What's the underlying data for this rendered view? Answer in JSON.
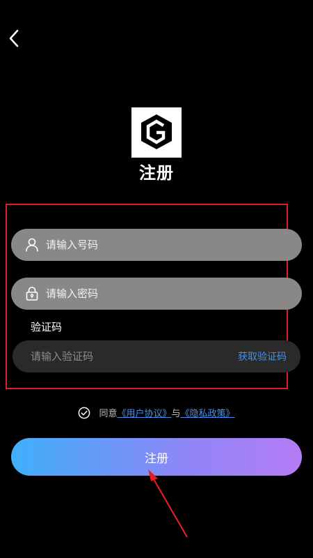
{
  "header": {
    "back_icon": "chevron-left-icon",
    "title": "注册"
  },
  "logo": {
    "icon": "hexagon-g-logo"
  },
  "form": {
    "account": {
      "icon": "user-icon",
      "placeholder": "请输入号码",
      "value": ""
    },
    "password": {
      "icon": "lock-icon",
      "placeholder": "请输入密码",
      "value": ""
    },
    "code_label": "验证码",
    "code": {
      "placeholder": "请输入验证码",
      "value": "",
      "get_code_label": "获取验证码"
    }
  },
  "agreement": {
    "check_icon": "check-circle-icon",
    "prefix": "同意",
    "user_agreement": "《用户协议》",
    "connector": "与",
    "privacy_policy": "《隐私政策》"
  },
  "submit": {
    "label": "注册"
  },
  "colors": {
    "background": "#000000",
    "input_fill": "#8a8787",
    "code_input_fill": "#2a2a2a",
    "link": "#4b8ee8",
    "gradient_start": "#3fb0fb",
    "gradient_end": "#b47cf5",
    "annotation": "#e02020"
  }
}
